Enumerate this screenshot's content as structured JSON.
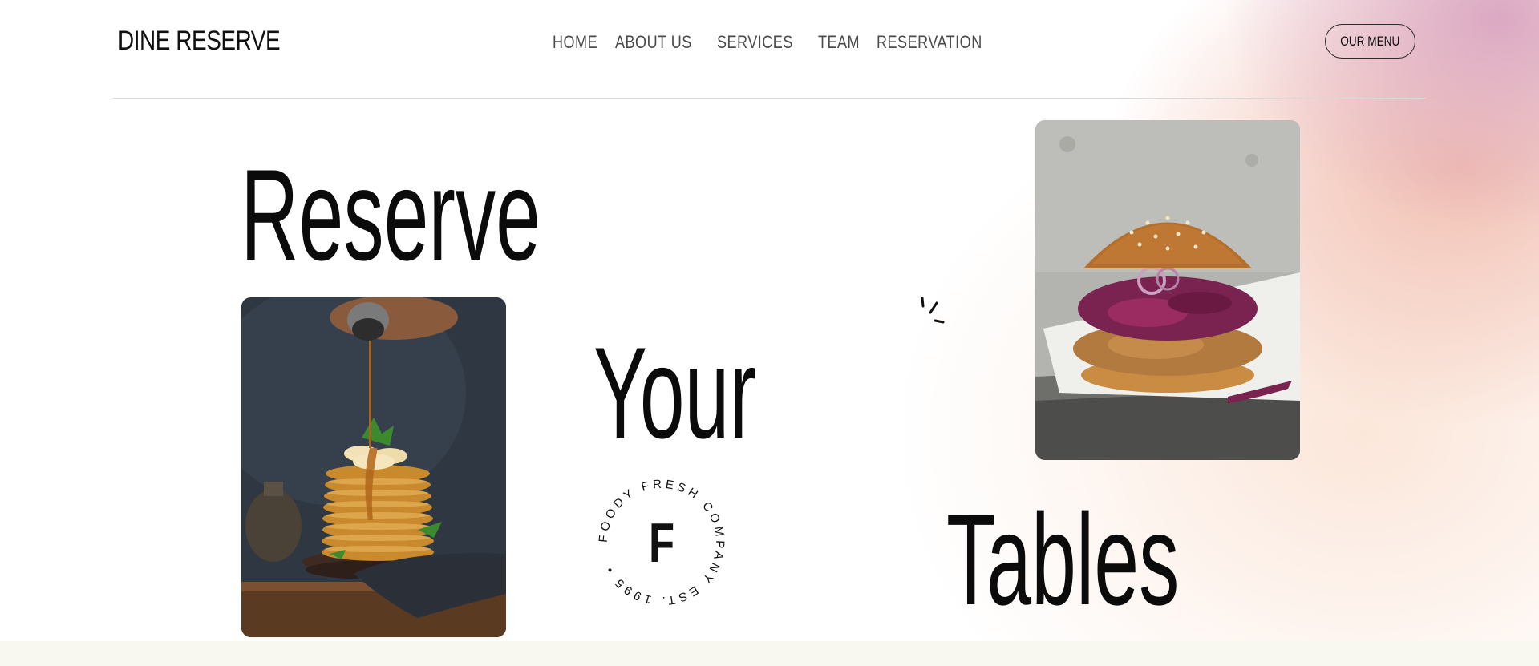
{
  "brand": {
    "name": "DINE RESERVE"
  },
  "nav": {
    "items": [
      {
        "label": "HOME"
      },
      {
        "label": "ABOUT US"
      },
      {
        "label": "SERVICES"
      },
      {
        "label": "TEAM"
      },
      {
        "label": "RESERVATION"
      }
    ]
  },
  "header": {
    "menu_button_label": "OUR MENU"
  },
  "hero": {
    "word1": "Reserve",
    "word2": "Your",
    "word3": "Tables"
  },
  "badge": {
    "letter": "F",
    "circle_text": "FOODY FRESH COMPANY EST. 1995 •"
  },
  "images": {
    "left": "pancakes-photo",
    "right": "burger-photo"
  },
  "colors": {
    "text": "#0b0b0b",
    "nav_text": "#4b4b4b",
    "divider": "#d9d9d9",
    "gradient_pink": "#d69ebe",
    "gradient_peach": "#eeb0a0",
    "bottom_strip": "#f8f8f1"
  }
}
